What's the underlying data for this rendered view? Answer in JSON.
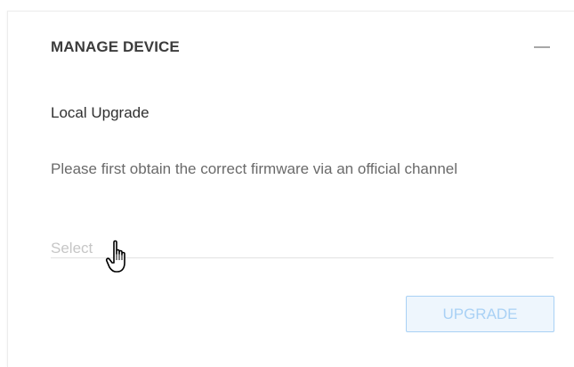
{
  "panel": {
    "title": "MANAGE DEVICE",
    "collapse_icon": "minus-icon"
  },
  "local_upgrade": {
    "label": "Local Upgrade",
    "hint": "Please first obtain the correct firmware via an official channel",
    "select": {
      "placeholder": "Select"
    },
    "upgrade_button": {
      "label": "UPGRADE",
      "state": "disabled"
    }
  },
  "cursor": {
    "icon": "hand-pointer-icon"
  },
  "colors": {
    "title_text": "#3c3c3c",
    "hint_text": "#6a6a6a",
    "placeholder_text": "#c6c6c6",
    "button_border": "#a9d1f5",
    "button_bg": "#eef6fd"
  }
}
